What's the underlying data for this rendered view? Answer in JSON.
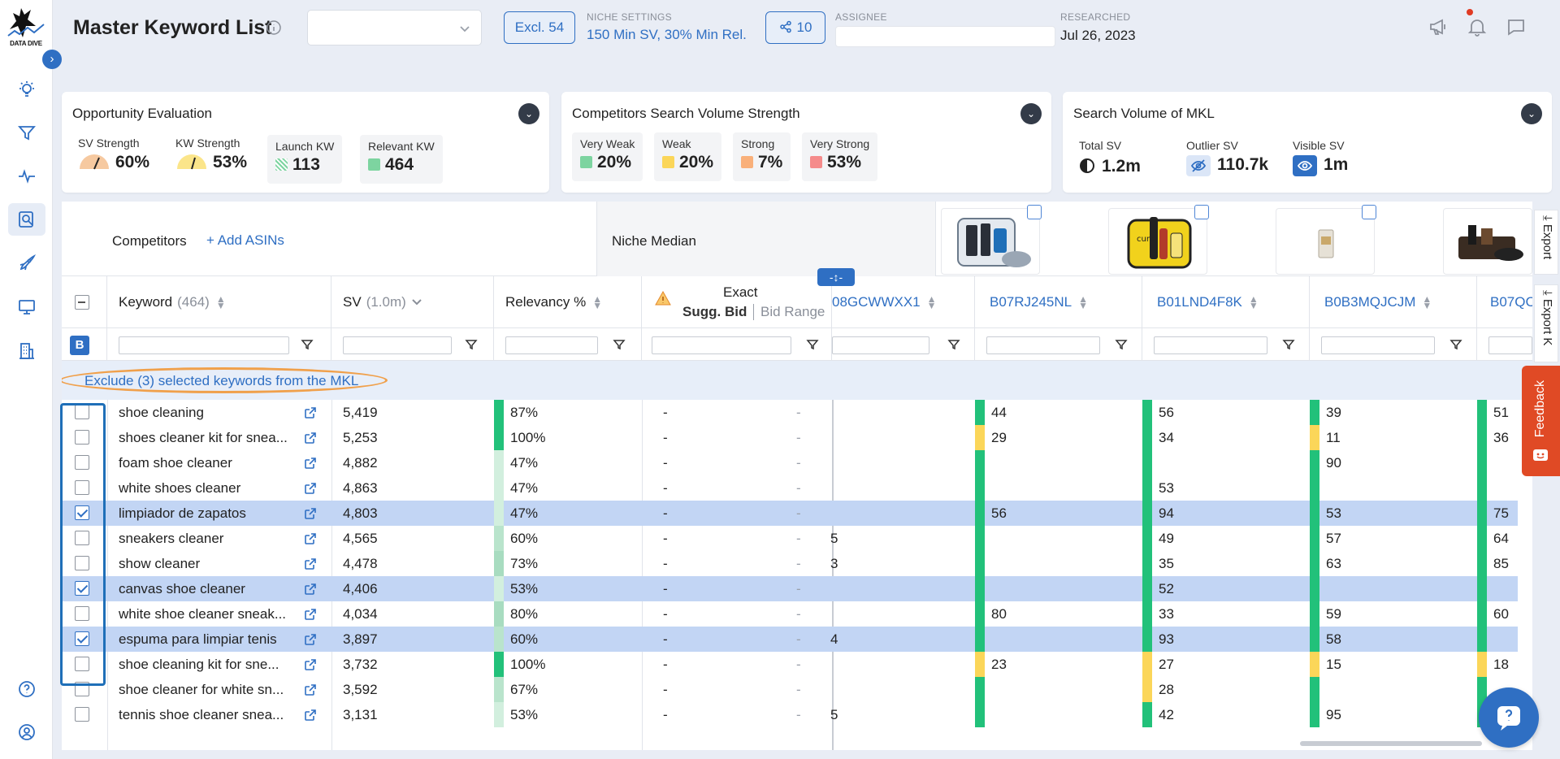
{
  "app": {
    "logo_text": "DATA DIVE"
  },
  "header": {
    "title": "Master Keyword List",
    "excl_label": "Excl. 54",
    "niche_settings_caption": "NICHE SETTINGS",
    "niche_settings_value": "150 Min SV, 30% Min Rel.",
    "share_count": "10",
    "assignee_caption": "ASSIGNEE",
    "researched_caption": "RESEARCHED",
    "researched_value": "Jul 26, 2023"
  },
  "cards": {
    "opportunity": {
      "title": "Opportunity Evaluation",
      "sv_strength_label": "SV Strength",
      "sv_strength_value": "60%",
      "kw_strength_label": "KW Strength",
      "kw_strength_value": "53%",
      "launch_kw_label": "Launch KW",
      "launch_kw_value": "113",
      "relevant_kw_label": "Relevant KW",
      "relevant_kw_value": "464"
    },
    "competitors": {
      "title": "Competitors Search Volume Strength",
      "items": [
        {
          "label": "Very Weak",
          "value": "20%",
          "color": "#7dd4a0"
        },
        {
          "label": "Weak",
          "value": "20%",
          "color": "#fbd659"
        },
        {
          "label": "Strong",
          "value": "7%",
          "color": "#f9b07a"
        },
        {
          "label": "Very Strong",
          "value": "53%",
          "color": "#f58b8b"
        }
      ]
    },
    "search_volume": {
      "title": "Search Volume of MKL",
      "total_label": "Total SV",
      "total_value": "1.2m",
      "outlier_label": "Outlier SV",
      "outlier_value": "110.7k",
      "visible_label": "Visible SV",
      "visible_value": "1m"
    }
  },
  "table": {
    "competitors_label": "Competitors",
    "add_asins_label": "+ Add ASINs",
    "niche_median_label": "Niche Median",
    "columns": {
      "keyword": "Keyword",
      "keyword_count": "(464)",
      "sv": "SV",
      "sv_total": "(1.0m)",
      "relevancy": "Relevancy %",
      "exact": "Exact",
      "sugg_bid": "Sugg. Bid",
      "bid_range": "Bid Range",
      "asin1": "08GCWWXX1",
      "asin2": "B07RJ245NL",
      "asin3": "B01LND4F8K",
      "asin4": "B0B3MQJCJM",
      "asin5": "B07QC"
    },
    "exclude_label": "Exclude (3) selected keywords from the MKL",
    "b_badge": "B",
    "rows": [
      {
        "kw": "shoe cleaning",
        "sv": "5,419",
        "rel": "87%",
        "bid": "-",
        "range": "-",
        "a1": "",
        "a2": "44",
        "a3": "56",
        "a4": "39",
        "a5": "51",
        "sel": false
      },
      {
        "kw": "shoes cleaner kit for snea...",
        "sv": "5,253",
        "rel": "100%",
        "bid": "-",
        "range": "-",
        "a1": "",
        "a2": "29",
        "a3": "34",
        "a4": "11",
        "a5": "36",
        "sel": false
      },
      {
        "kw": "foam shoe cleaner",
        "sv": "4,882",
        "rel": "47%",
        "bid": "-",
        "range": "-",
        "a1": "",
        "a2": "",
        "a3": "",
        "a4": "90",
        "a5": "",
        "sel": false
      },
      {
        "kw": "white shoes cleaner",
        "sv": "4,863",
        "rel": "47%",
        "bid": "-",
        "range": "-",
        "a1": "",
        "a2": "",
        "a3": "53",
        "a4": "",
        "a5": "",
        "sel": false
      },
      {
        "kw": "limpiador de zapatos",
        "sv": "4,803",
        "rel": "47%",
        "bid": "-",
        "range": "-",
        "a1": "",
        "a2": "56",
        "a3": "94",
        "a4": "53",
        "a5": "75",
        "sel": true
      },
      {
        "kw": "sneakers cleaner",
        "sv": "4,565",
        "rel": "60%",
        "bid": "-",
        "range": "-",
        "a1": "5",
        "a2": "",
        "a3": "49",
        "a4": "57",
        "a5": "64",
        "sel": false
      },
      {
        "kw": "show cleaner",
        "sv": "4,478",
        "rel": "73%",
        "bid": "-",
        "range": "-",
        "a1": "3",
        "a2": "",
        "a3": "35",
        "a4": "63",
        "a5": "85",
        "sel": false
      },
      {
        "kw": "canvas shoe cleaner",
        "sv": "4,406",
        "rel": "53%",
        "bid": "-",
        "range": "-",
        "a1": "",
        "a2": "",
        "a3": "52",
        "a4": "",
        "a5": "",
        "sel": true
      },
      {
        "kw": "white shoe cleaner sneak...",
        "sv": "4,034",
        "rel": "80%",
        "bid": "-",
        "range": "-",
        "a1": "",
        "a2": "80",
        "a3": "33",
        "a4": "59",
        "a5": "60",
        "sel": false
      },
      {
        "kw": "espuma para limpiar tenis",
        "sv": "3,897",
        "rel": "60%",
        "bid": "-",
        "range": "-",
        "a1": "4",
        "a2": "",
        "a3": "93",
        "a4": "58",
        "a5": "",
        "sel": true
      },
      {
        "kw": "shoe cleaning kit for sne...",
        "sv": "3,732",
        "rel": "100%",
        "bid": "-",
        "range": "-",
        "a1": "",
        "a2": "23",
        "a3": "27",
        "a4": "15",
        "a5": "18",
        "sel": false
      },
      {
        "kw": "shoe cleaner for white sn...",
        "sv": "3,592",
        "rel": "67%",
        "bid": "-",
        "range": "-",
        "a1": "",
        "a2": "",
        "a3": "28",
        "a4": "",
        "a5": "",
        "sel": false
      },
      {
        "kw": "tennis shoe cleaner snea...",
        "sv": "3,131",
        "rel": "53%",
        "bid": "-",
        "range": "-",
        "a1": "5",
        "a2": "",
        "a3": "42",
        "a4": "95",
        "a5": "",
        "sel": false
      }
    ]
  },
  "side": {
    "export1": "Export",
    "export2": "Export K",
    "feedback": "Feedback"
  },
  "colors": {
    "accent": "#2f6fc3",
    "green": "#22c17a",
    "yellow": "#fbd659",
    "orange": "#f9a56e",
    "highlight_oval": "#f0a04b",
    "selected_row": "#c2d5f4"
  }
}
